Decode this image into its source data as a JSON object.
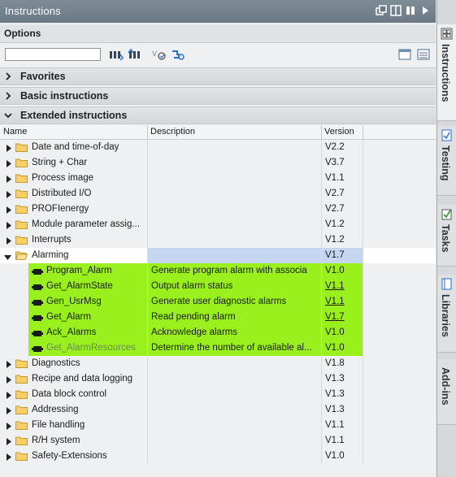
{
  "window": {
    "title": "Instructions"
  },
  "options": {
    "title": "Options",
    "search_value": ""
  },
  "sections": {
    "favorites": "Favorites",
    "basic": "Basic instructions",
    "extended": "Extended instructions"
  },
  "columns": {
    "name": "Name",
    "description": "Description",
    "version": "Version"
  },
  "folders_top": [
    {
      "name": "Date and time-of-day",
      "version": "V2.2"
    },
    {
      "name": "String + Char",
      "version": "V3.7"
    },
    {
      "name": "Process image",
      "version": "V1.1"
    },
    {
      "name": "Distributed I/O",
      "version": "V2.7"
    },
    {
      "name": "PROFIenergy",
      "version": "V2.7"
    },
    {
      "name": "Module parameter assig...",
      "version": "V1.2"
    },
    {
      "name": "Interrupts",
      "version": "V1.2"
    }
  ],
  "alarming": {
    "name": "Alarming",
    "version": "V1.7"
  },
  "alarm_items": [
    {
      "name": "Program_Alarm",
      "description": "Generate program alarm with associa",
      "version": "V1.0",
      "underline": false,
      "disabled": false
    },
    {
      "name": "Get_AlarmState",
      "description": "Output alarm status",
      "version": "V1.1",
      "underline": true,
      "disabled": false
    },
    {
      "name": "Gen_UsrMsg",
      "description": "Generate user diagnostic alarms",
      "version": "V1.1",
      "underline": true,
      "disabled": false
    },
    {
      "name": "Get_Alarm",
      "description": "Read pending alarm",
      "version": "V1.7",
      "underline": true,
      "disabled": false
    },
    {
      "name": "Ack_Alarms",
      "description": "Acknowledge alarms",
      "version": "V1.0",
      "underline": false,
      "disabled": false
    },
    {
      "name": "Get_AlarmResources",
      "description": "Determine the number of available al...",
      "version": "V1.0",
      "underline": false,
      "disabled": true
    }
  ],
  "folders_bottom": [
    {
      "name": "Diagnostics",
      "version": "V1.8"
    },
    {
      "name": "Recipe and data logging",
      "version": "V1.3"
    },
    {
      "name": "Data block control",
      "version": "V1.3"
    },
    {
      "name": "Addressing",
      "version": "V1.3"
    },
    {
      "name": "File handling",
      "version": "V1.1"
    },
    {
      "name": "R/H system",
      "version": "V1.1"
    },
    {
      "name": "Safety-Extensions",
      "version": "V1.0"
    }
  ],
  "sidebar_tabs": [
    "Instructions",
    "Testing",
    "Tasks",
    "Libraries",
    "Add-ins"
  ],
  "colors": {
    "highlight": "#99f01c",
    "selected_row": "#c4d6f0",
    "titlebar": "#6b7984"
  }
}
